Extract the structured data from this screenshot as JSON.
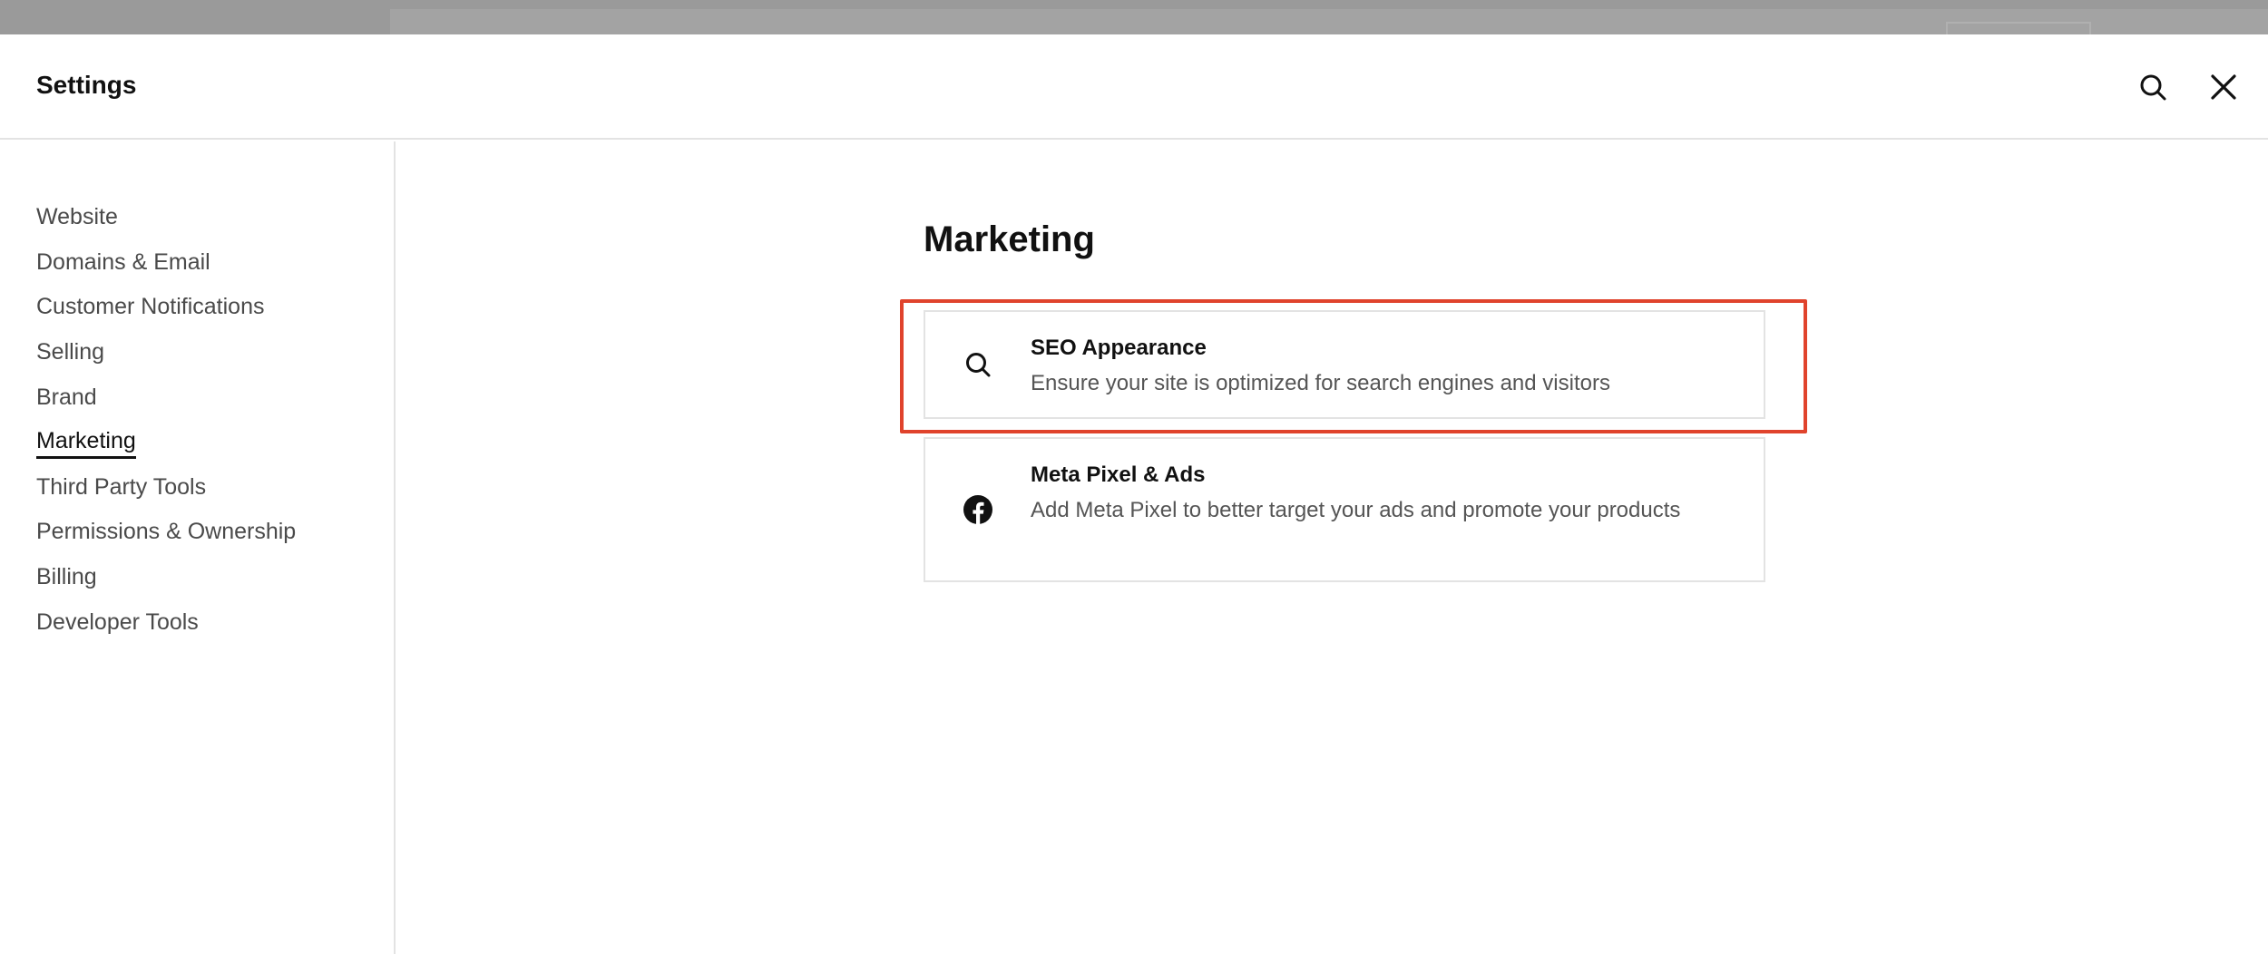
{
  "header": {
    "title": "Settings",
    "search_icon": "search-icon",
    "close_icon": "close-icon"
  },
  "sidebar": {
    "items": [
      {
        "label": "Website"
      },
      {
        "label": "Domains & Email"
      },
      {
        "label": "Customer Notifications"
      },
      {
        "label": "Selling"
      },
      {
        "label": "Brand"
      },
      {
        "label": "Marketing",
        "active": true
      },
      {
        "label": "Third Party Tools"
      },
      {
        "label": "Permissions & Ownership"
      },
      {
        "label": "Billing"
      },
      {
        "label": "Developer Tools"
      }
    ]
  },
  "main": {
    "title": "Marketing",
    "cards": [
      {
        "icon": "search-icon",
        "title": "SEO Appearance",
        "description": "Ensure your site is optimized for search engines and visitors",
        "highlighted": true
      },
      {
        "icon": "facebook-icon",
        "title": "Meta Pixel & Ads",
        "description": "Add Meta Pixel to better target your ads and promote your products"
      }
    ]
  },
  "colors": {
    "highlight": "#e0432c",
    "text": "#111111",
    "muted": "#555555",
    "border": "#e3e3e3"
  }
}
